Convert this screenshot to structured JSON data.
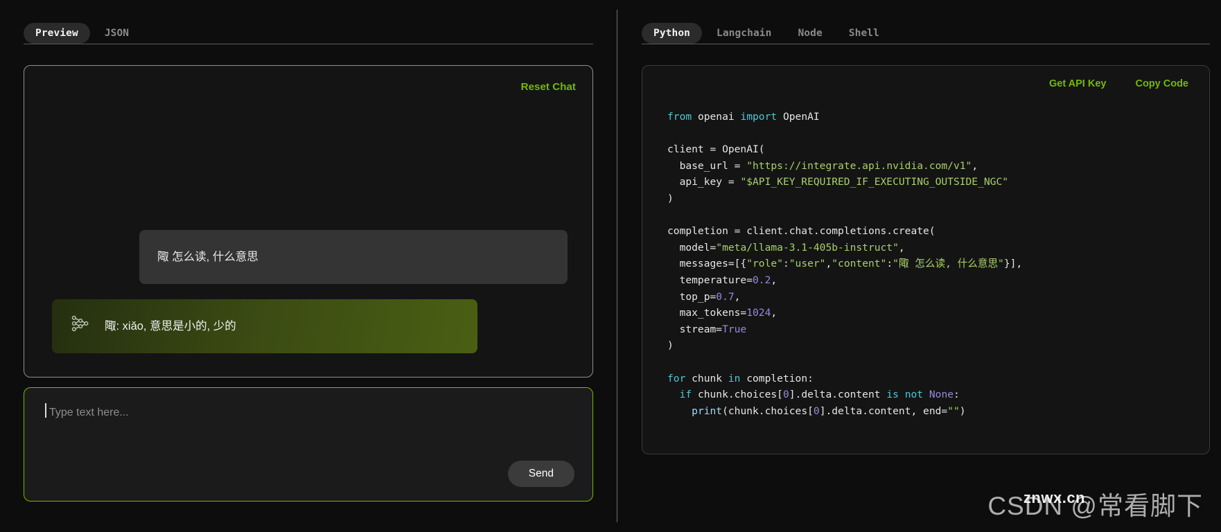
{
  "left_panel": {
    "tabs": [
      {
        "label": "Preview",
        "active": true
      },
      {
        "label": "JSON",
        "active": false
      }
    ],
    "reset_chat_label": "Reset Chat",
    "messages": [
      {
        "role": "user",
        "text": "陬 怎么读, 什么意思"
      },
      {
        "role": "assistant",
        "icon": "neural-network-icon",
        "text": "陬: xiǎo, 意思是小的, 少的"
      }
    ],
    "composer": {
      "placeholder": "Type text here...",
      "value": "",
      "send_label": "Send"
    }
  },
  "right_panel": {
    "tabs": [
      {
        "label": "Python",
        "active": true
      },
      {
        "label": "Langchain",
        "active": false
      },
      {
        "label": "Node",
        "active": false
      },
      {
        "label": "Shell",
        "active": false
      }
    ],
    "actions": [
      {
        "label": "Get API Key"
      },
      {
        "label": "Copy Code"
      }
    ],
    "code_language": "python",
    "code_lines": [
      [
        {
          "t": "from",
          "c": "k"
        },
        {
          "t": " openai ",
          "c": "pl"
        },
        {
          "t": "import",
          "c": "k"
        },
        {
          "t": " OpenAI",
          "c": "pl"
        }
      ],
      [],
      [
        {
          "t": "client = OpenAI(",
          "c": "pl"
        }
      ],
      [
        {
          "t": "  base_url = ",
          "c": "pl"
        },
        {
          "t": "\"https://integrate.api.nvidia.com/v1\"",
          "c": "s"
        },
        {
          "t": ",",
          "c": "pl"
        }
      ],
      [
        {
          "t": "  api_key = ",
          "c": "pl"
        },
        {
          "t": "\"$API_KEY_REQUIRED_IF_EXECUTING_OUTSIDE_NGC\"",
          "c": "s"
        }
      ],
      [
        {
          "t": ")",
          "c": "pl"
        }
      ],
      [],
      [
        {
          "t": "completion = client.chat.completions.create(",
          "c": "pl"
        }
      ],
      [
        {
          "t": "  model=",
          "c": "pl"
        },
        {
          "t": "\"meta/llama-3.1-405b-instruct\"",
          "c": "s"
        },
        {
          "t": ",",
          "c": "pl"
        }
      ],
      [
        {
          "t": "  messages=[{",
          "c": "pl"
        },
        {
          "t": "\"role\"",
          "c": "s"
        },
        {
          "t": ":",
          "c": "pl"
        },
        {
          "t": "\"user\"",
          "c": "s"
        },
        {
          "t": ",",
          "c": "pl"
        },
        {
          "t": "\"content\"",
          "c": "s"
        },
        {
          "t": ":",
          "c": "pl"
        },
        {
          "t": "\"陬 怎么读, 什么意思\"",
          "c": "s"
        },
        {
          "t": "}],",
          "c": "pl"
        }
      ],
      [
        {
          "t": "  temperature=",
          "c": "pl"
        },
        {
          "t": "0.2",
          "c": "n"
        },
        {
          "t": ",",
          "c": "pl"
        }
      ],
      [
        {
          "t": "  top_p=",
          "c": "pl"
        },
        {
          "t": "0.7",
          "c": "n"
        },
        {
          "t": ",",
          "c": "pl"
        }
      ],
      [
        {
          "t": "  max_tokens=",
          "c": "pl"
        },
        {
          "t": "1024",
          "c": "n"
        },
        {
          "t": ",",
          "c": "pl"
        }
      ],
      [
        {
          "t": "  stream=",
          "c": "pl"
        },
        {
          "t": "True",
          "c": "n"
        }
      ],
      [
        {
          "t": ")",
          "c": "pl"
        }
      ],
      [],
      [
        {
          "t": "for",
          "c": "k"
        },
        {
          "t": " chunk ",
          "c": "pl"
        },
        {
          "t": "in",
          "c": "k"
        },
        {
          "t": " completion:",
          "c": "pl"
        }
      ],
      [
        {
          "t": "  ",
          "c": "pl"
        },
        {
          "t": "if",
          "c": "k"
        },
        {
          "t": " chunk.choices[",
          "c": "pl"
        },
        {
          "t": "0",
          "c": "n"
        },
        {
          "t": "].delta.content ",
          "c": "pl"
        },
        {
          "t": "is",
          "c": "k"
        },
        {
          "t": " ",
          "c": "pl"
        },
        {
          "t": "not",
          "c": "k"
        },
        {
          "t": " ",
          "c": "pl"
        },
        {
          "t": "None",
          "c": "n"
        },
        {
          "t": ":",
          "c": "pl"
        }
      ],
      [
        {
          "t": "    ",
          "c": "pl"
        },
        {
          "t": "print",
          "c": "fn"
        },
        {
          "t": "(chunk.choices[",
          "c": "pl"
        },
        {
          "t": "0",
          "c": "n"
        },
        {
          "t": "].delta.content, end=",
          "c": "pl"
        },
        {
          "t": "\"\"",
          "c": "s"
        },
        {
          "t": ")",
          "c": "pl"
        }
      ]
    ]
  },
  "watermark": {
    "main": "CSDN @常看脚下",
    "sub": "znwx.cn"
  },
  "colors": {
    "accent_green": "#76b900",
    "background": "#0d0d0d",
    "panel_background": "#141414",
    "user_bubble": "#343434",
    "keyword": "#4ec9d6",
    "string": "#a8d16a",
    "number": "#9b87e0"
  }
}
